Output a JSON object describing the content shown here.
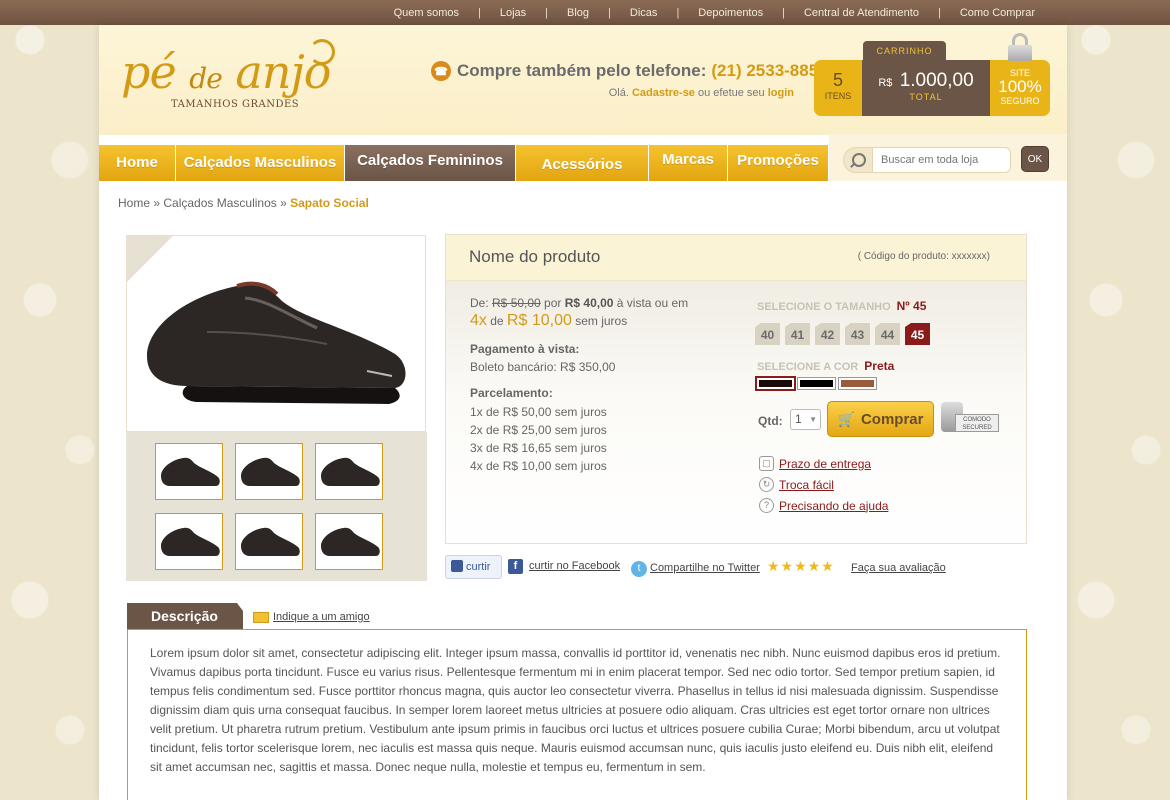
{
  "topnav": [
    "Quem somos",
    "Lojas",
    "Blog",
    "Dicas",
    "Depoimentos",
    "Central de Atendimento",
    "Como Comprar"
  ],
  "brand": {
    "name_1": "pé",
    "name_2": "de",
    "name_3": "anjo",
    "tagline": "TAMANHOS GRANDES"
  },
  "header": {
    "phone_label": "Compre também pelo telefone:",
    "phone_number": "(21) 2533-8855",
    "welcome_pre": "Olá. ",
    "welcome_signup": "Cadastre-se",
    "welcome_mid": " ou efetue seu ",
    "welcome_login": "login"
  },
  "cart": {
    "tab_label": "CARRINHO",
    "items_count": "5",
    "items_label": "ITENS",
    "currency": "R$",
    "total_value": "1.000,00",
    "total_label": "TOTAL",
    "secure_line1": "SITE",
    "secure_line2": "100%",
    "secure_line3": "SEGURO"
  },
  "mainnav": [
    "Home",
    "Calçados Masculinos",
    "Calçados Femininos",
    "Acessórios",
    "Marcas",
    "Promoções"
  ],
  "search": {
    "placeholder": "Buscar em toda loja",
    "button": "OK"
  },
  "breadcrumb": {
    "home": "Home",
    "sep": " » ",
    "category": "Calçados Masculinos",
    "current": "Sapato Social"
  },
  "product": {
    "name": "Nome do produto",
    "code": "( Código do produto: xxxxxxx)",
    "price_from_label": "De: ",
    "price_from": "R$ 50,00",
    "price_by_label": " por ",
    "price_now": "R$ 40,00",
    "price_cash_suffix": " à vista ou em",
    "installments_count": "4x",
    "installments_de": " de ",
    "installments_value": "R$ 10,00",
    "installments_suffix": " sem juros",
    "cash_title": "Pagamento à vista:",
    "cash_text": "Boleto bancário: R$ 350,00",
    "parcel_title": "Parcelamento:",
    "parcel_list": [
      "1x de R$ 50,00 sem juros",
      "2x de R$ 25,00 sem juros",
      "3x de R$ 16,65 sem juros",
      "4x de R$ 10,00 sem juros"
    ],
    "size_label": "SELECIONE O TAMANHO",
    "size_selected": "Nº 45",
    "sizes": [
      "40",
      "41",
      "42",
      "43",
      "44",
      "45"
    ],
    "color_label": "SELECIONE A COR",
    "color_selected": "Preta",
    "colors": [
      "#1a0a0a",
      "#000000",
      "#9a5a3c"
    ],
    "qty_label": "Qtd:",
    "qty_value": "1",
    "buy_label": "Comprar",
    "secured_text": "COMODO SECURED",
    "links": [
      "Prazo de entrega",
      "Troca fácil",
      "Precisando de ajuda"
    ]
  },
  "social": {
    "like": "curtir",
    "facebook": "curtir no Facebook",
    "twitter": "Compartilhe no Twitter",
    "stars": "★★★★★",
    "rate": "Faça sua avaliação"
  },
  "description": {
    "tab": "Descrição",
    "friend_link": "Indique a um amigo",
    "text": "Lorem ipsum dolor sit amet, consectetur adipiscing elit. Integer ipsum massa, convallis id porttitor id, venenatis nec nibh. Nunc euismod dapibus eros id pretium. Vivamus dapibus porta tincidunt. Fusce eu varius risus. Pellentesque fermentum mi in enim placerat tempor. Sed nec odio tortor. Sed tempor pretium sapien, id tempus felis condimentum sed. Fusce porttitor rhoncus magna, quis auctor leo consectetur viverra. Phasellus in tellus id nisi malesuada dignissim. Suspendisse dignissim diam quis urna consequat faucibus. In semper lorem laoreet metus ultricies at posuere odio aliquam. Cras ultricies est eget tortor ornare non ultrices velit pretium. Ut pharetra rutrum pretium. Vestibulum ante ipsum primis in faucibus orci luctus et ultrices posuere cubilia Curae; Morbi bibendum, arcu ut volutpat tincidunt, felis tortor scelerisque lorem, nec iaculis est massa quis neque. Mauris euismod accumsan nunc, quis iaculis justo eleifend eu. Duis nibh elit, eleifend sit amet accumsan nec, sagittis et massa. Donec neque nulla, molestie et tempus eu, fermentum in sem."
  }
}
